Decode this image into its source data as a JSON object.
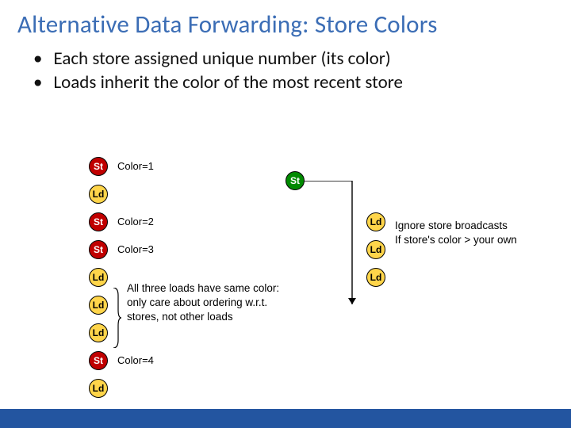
{
  "title": "Alternative Data Forwarding: Store Colors",
  "bullets": [
    "Each store assigned unique number (its color)",
    "Loads inherit the color of the most recent store"
  ],
  "left_column": [
    {
      "type": "st",
      "color_label": "Color=1"
    },
    {
      "type": "ld"
    },
    {
      "type": "st",
      "color_label": "Color=2"
    },
    {
      "type": "st",
      "color_label": "Color=3"
    },
    {
      "type": "ld"
    },
    {
      "type": "ld"
    },
    {
      "type": "ld"
    },
    {
      "type": "st",
      "color_label": "Color=4"
    },
    {
      "type": "ld"
    }
  ],
  "mid": {
    "st_label": "St",
    "right_ld_labels": [
      "Ld",
      "Ld",
      "Ld"
    ]
  },
  "brace_note": "All three loads have same color:\nonly care about ordering w.r.t.\nstores, not other loads",
  "right_note": "Ignore store broadcasts\nIf store's color > your own",
  "tokens": {
    "St": "St",
    "Ld": "Ld"
  }
}
